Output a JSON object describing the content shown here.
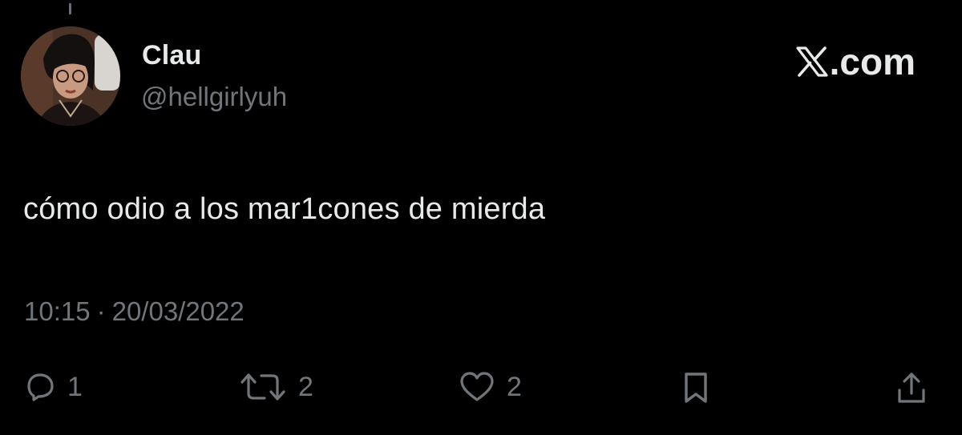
{
  "tweet": {
    "author": {
      "display_name": "Clau",
      "handle": "@hellgirlyuh"
    },
    "brand": {
      "logo_icon": "x-logo-icon",
      "domain_text": ".com"
    },
    "text": "cómo odio a los mar1cones de mierda",
    "time": "10:15",
    "separator": "·",
    "date": "20/03/2022",
    "actions": {
      "reply": {
        "icon": "reply-icon",
        "count": "1"
      },
      "retweet": {
        "icon": "retweet-icon",
        "count": "2"
      },
      "like": {
        "icon": "heart-icon",
        "count": "2"
      },
      "bookmark": {
        "icon": "bookmark-icon"
      },
      "share": {
        "icon": "share-icon"
      }
    }
  },
  "colors": {
    "background": "#000000",
    "primary_text": "#e7e9ea",
    "secondary_text": "#71767b"
  }
}
